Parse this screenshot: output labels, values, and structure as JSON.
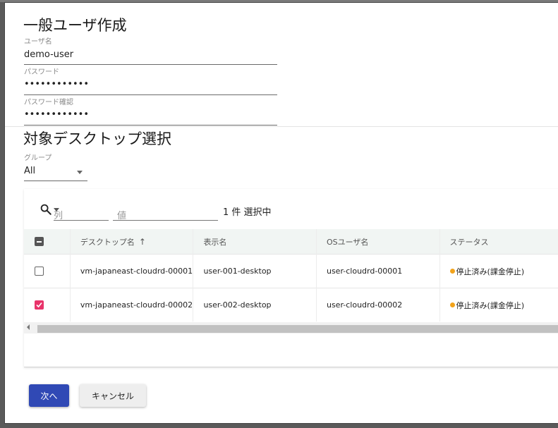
{
  "dialog": {
    "title": "一般ユーザ作成",
    "username": {
      "label": "ユーザ名",
      "value": "demo-user"
    },
    "password": {
      "label": "パスワード",
      "value": "••••••••••••"
    },
    "password_confirm": {
      "label": "パスワード確認",
      "value": "••••••••••••"
    }
  },
  "desktop_section": {
    "title": "対象デスクトップ選択",
    "group_label": "グループ",
    "group_value": "All"
  },
  "filter": {
    "column_placeholder": "列",
    "value_placeholder": "値",
    "selection_count": "1 件 選択中"
  },
  "table": {
    "columns": [
      "デスクトップ名",
      "表示名",
      "OSユーザ名",
      "ステータス"
    ],
    "sort_indicator": "↑",
    "rows": [
      {
        "desktop_name": "vm-japaneast-cloudrd-00001",
        "display_name": "user-001-desktop",
        "os_user": "user-cloudrd-00001",
        "status": "停止済み(課金停止)",
        "checked": false
      },
      {
        "desktop_name": "vm-japaneast-cloudrd-00002",
        "display_name": "user-002-desktop",
        "os_user": "user-cloudrd-00002",
        "status": "停止済み(課金停止)",
        "checked": true
      }
    ]
  },
  "actions": {
    "next_label": "次へ",
    "cancel_label": "キャンセル"
  },
  "colors": {
    "primary": "#3049b5",
    "checkbox_checked": "#e8336a",
    "status_stopped": "#f2a31b"
  },
  "icons": [
    "search-icon",
    "chevron-down-icon",
    "sort-ascending-icon",
    "status-dot-icon",
    "check-icon"
  ]
}
